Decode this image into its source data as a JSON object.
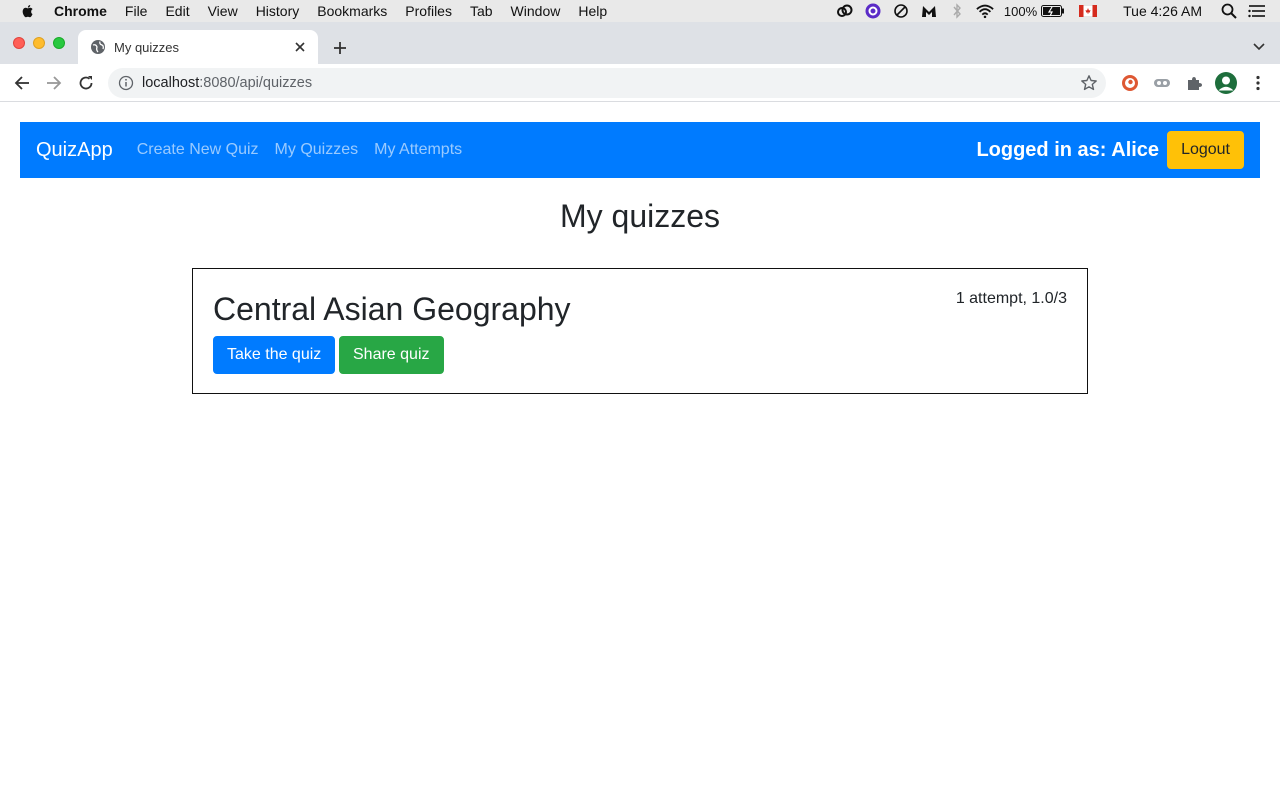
{
  "menubar": {
    "app_name": "Chrome",
    "items": [
      "File",
      "Edit",
      "View",
      "History",
      "Bookmarks",
      "Profiles",
      "Tab",
      "Window",
      "Help"
    ],
    "battery": "100%",
    "clock": "Tue 4:26 AM"
  },
  "browser": {
    "tab_title": "My quizzes",
    "url_host": "localhost",
    "url_path": ":8080/api/quizzes"
  },
  "navbar": {
    "brand": "QuizApp",
    "links": [
      "Create New Quiz",
      "My Quizzes",
      "My Attempts"
    ],
    "logged_in_text": "Logged in as: Alice",
    "logout_label": "Logout"
  },
  "page": {
    "title": "My quizzes"
  },
  "quizzes": [
    {
      "name": "Central Asian Geography",
      "attempts_text": "1 attempt, 1.0/3",
      "take_label": "Take the quiz",
      "share_label": "Share quiz"
    }
  ],
  "colors": {
    "primary": "#007bff",
    "success": "#28a745",
    "warning": "#ffc107"
  }
}
